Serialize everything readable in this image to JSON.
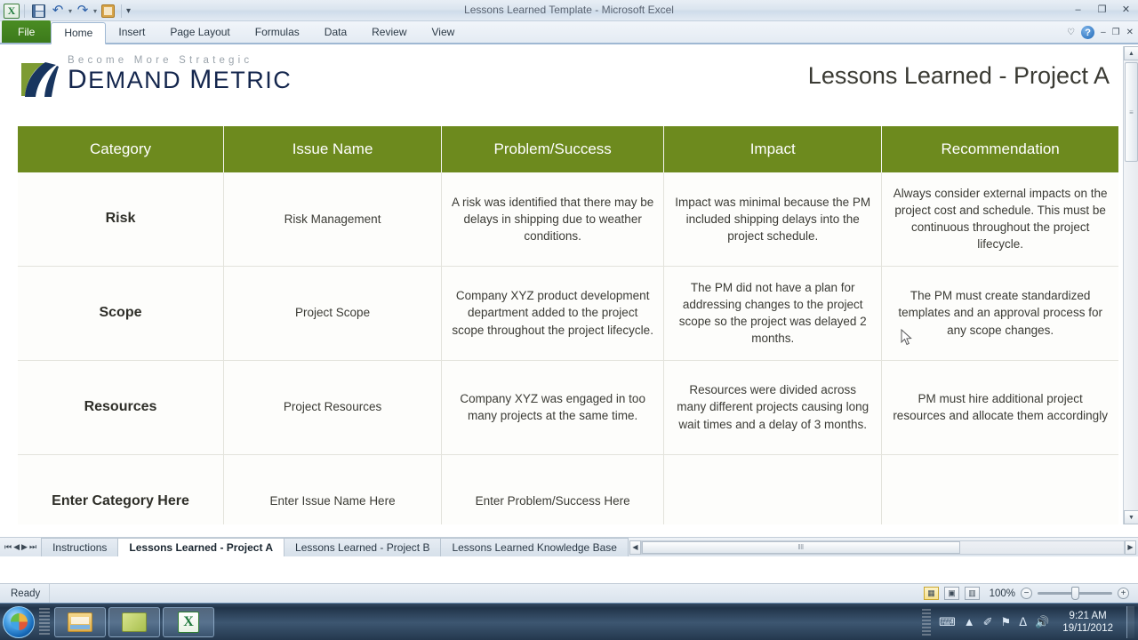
{
  "window": {
    "title": "Lessons Learned Template  -  Microsoft Excel",
    "minimize_label": "–",
    "restore_label": "❐",
    "close_label": "✕"
  },
  "quick_access": {
    "excel_logo": "X",
    "save_icon": "save-icon",
    "undo_icon": "↶",
    "undo_arrow": "▾",
    "redo_icon": "↷",
    "redo_arrow": "▾",
    "paste_icon": "paste-icon",
    "customize_arrow": "▾"
  },
  "ribbon": {
    "tabs": [
      {
        "label": "File",
        "active": false,
        "file": true
      },
      {
        "label": "Home",
        "active": true,
        "file": false
      },
      {
        "label": "Insert",
        "active": false,
        "file": false
      },
      {
        "label": "Page Layout",
        "active": false,
        "file": false
      },
      {
        "label": "Formulas",
        "active": false,
        "file": false
      },
      {
        "label": "Data",
        "active": false,
        "file": false
      },
      {
        "label": "Review",
        "active": false,
        "file": false
      },
      {
        "label": "View",
        "active": false,
        "file": false
      }
    ],
    "heart_icon": "♡",
    "help_label": "?",
    "minimize_ribbon": "–",
    "restore_ribbon": "❐",
    "close_ribbon": "✕"
  },
  "branding": {
    "tagline": "Become   More   Strategic",
    "name_part1": "D",
    "name_rest1": "EMAND ",
    "name_part2": "M",
    "name_rest2": "ETRIC"
  },
  "document": {
    "title": "Lessons Learned - Project A"
  },
  "table": {
    "headers": [
      "Category",
      "Issue Name",
      "Problem/Success",
      "Impact",
      "Recommendation"
    ],
    "header_color": "#6d8a1e",
    "rows": [
      {
        "category": "Risk",
        "issue_name": "Risk Management",
        "problem_success": "A risk was identified that there may be delays in shipping due to weather conditions.",
        "impact": "Impact was minimal because the PM included shipping delays into the project schedule.",
        "recommendation": "Always consider external impacts on the project cost and schedule. This must be continuous throughout the project lifecycle."
      },
      {
        "category": "Scope",
        "issue_name": "Project Scope",
        "problem_success": "Company XYZ product development department added to the project scope throughout the project lifecycle.",
        "impact": "The PM did not have a plan for addressing changes to the project scope so the project was delayed 2 months.",
        "recommendation": "The PM must create standardized templates and an approval process for any scope changes."
      },
      {
        "category": "Resources",
        "issue_name": "Project Resources",
        "problem_success": "Company XYZ was engaged in too many projects at the same time.",
        "impact": "Resources were divided across many different projects causing long wait times and a delay of 3 months.",
        "recommendation": "PM must hire additional project resources and allocate them accordingly"
      },
      {
        "category": "Enter Category Here",
        "issue_name": "Enter Issue Name Here",
        "problem_success": "Enter Problem/Success Here",
        "impact": "",
        "recommendation": ""
      }
    ]
  },
  "sheet_tabs": {
    "nav_first": "⏮",
    "nav_prev": "◀",
    "nav_next": "▶",
    "nav_last": "⏭",
    "items": [
      {
        "label": "Instructions",
        "active": false
      },
      {
        "label": "Lessons Learned - Project A",
        "active": true
      },
      {
        "label": "Lessons Learned - Project B",
        "active": false
      },
      {
        "label": "Lessons Learned Knowledge Base",
        "active": false
      }
    ]
  },
  "scrollbars": {
    "v_up": "▲",
    "v_down": "▼",
    "v_grip": "≡",
    "h_left": "◀",
    "h_right": "▶",
    "h_grip": "‖‖"
  },
  "status_bar": {
    "state": "Ready",
    "view_normal": "▦",
    "view_layout": "▣",
    "view_pagebreak": "▥",
    "zoom_level": "100%",
    "zoom_out": "−",
    "zoom_in": "+"
  },
  "taskbar": {
    "start_label": "start-orb",
    "items": [
      {
        "name": "windows-explorer",
        "icon": "folder-icon"
      },
      {
        "name": "notes-app",
        "icon": "stack-icon"
      },
      {
        "name": "microsoft-excel",
        "icon": "excel-icon"
      }
    ],
    "tray": {
      "keyboard_icon": "⌨",
      "show_hidden_icon": "▲",
      "pin_icon": "✐",
      "action_center_icon": "⚑",
      "network_icon": "ᐃ",
      "volume_icon": "🔊",
      "time": "9:21 AM",
      "date": "19/11/2012"
    }
  }
}
